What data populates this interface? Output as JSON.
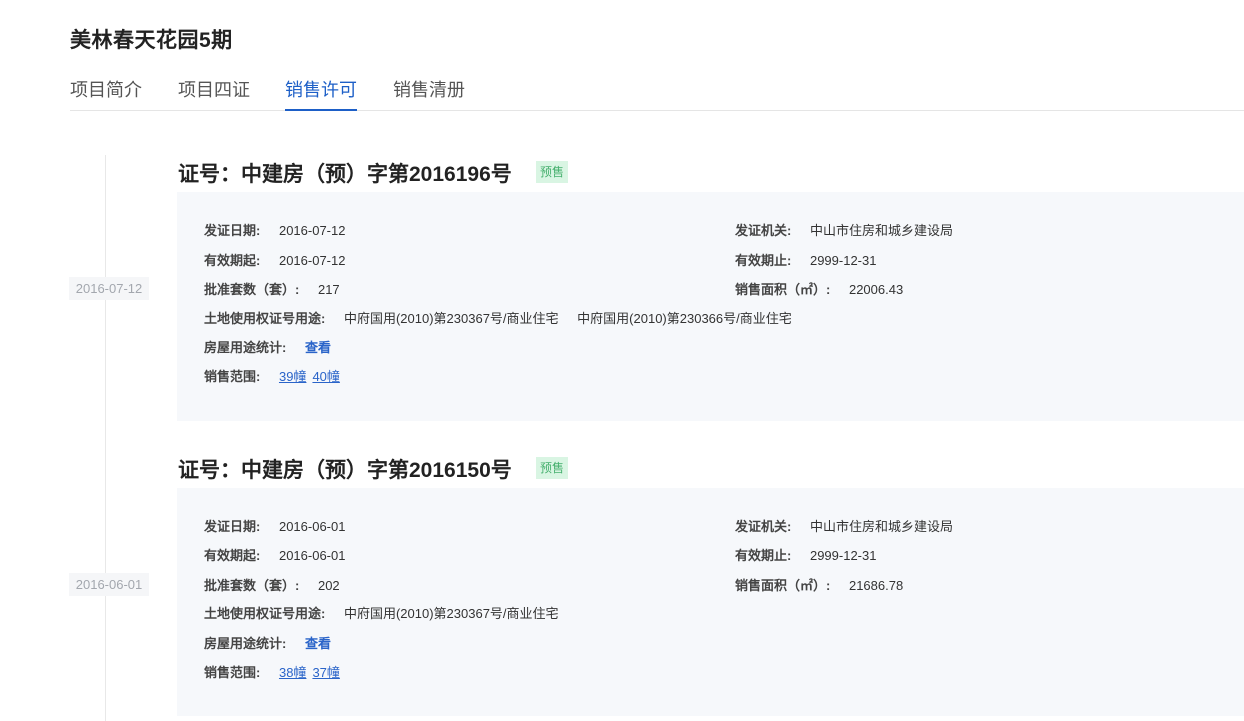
{
  "project": {
    "title": "美林春天花园5期"
  },
  "tabs": [
    {
      "label": "项目简介"
    },
    {
      "label": "项目四证"
    },
    {
      "label": "销售许可"
    },
    {
      "label": "销售清册"
    }
  ],
  "permits": [
    {
      "date": "2016-07-12",
      "title": "证号：中建房（预）字第2016196号",
      "badge": "预售",
      "issue_date_label": "发证日期:",
      "issue_date": "2016-07-12",
      "authority_label": "发证机关:",
      "authority": "中山市住房和城乡建设局",
      "valid_from_label": "有效期起:",
      "valid_from": "2016-07-12",
      "valid_to_label": "有效期止:",
      "valid_to": "2999-12-31",
      "units_label": "批准套数（套）:",
      "units": "217",
      "area_label": "销售面积（㎡）:",
      "area": "22006.43",
      "land_label": "土地使用权证号用途:",
      "land": [
        "中府国用(2010)第230367号/商业住宅",
        "中府国用(2010)第230366号/商业住宅"
      ],
      "usage_label": "房屋用途统计:",
      "usage_link": "查看",
      "scope_label": "销售范围:",
      "scope": [
        "39幢",
        "40幢"
      ]
    },
    {
      "date": "2016-06-01",
      "title": "证号：中建房（预）字第2016150号",
      "badge": "预售",
      "issue_date_label": "发证日期:",
      "issue_date": "2016-06-01",
      "authority_label": "发证机关:",
      "authority": "中山市住房和城乡建设局",
      "valid_from_label": "有效期起:",
      "valid_from": "2016-06-01",
      "valid_to_label": "有效期止:",
      "valid_to": "2999-12-31",
      "units_label": "批准套数（套）:",
      "units": "202",
      "area_label": "销售面积（㎡）:",
      "area": "21686.78",
      "land_label": "土地使用权证号用途:",
      "land": [
        "中府国用(2010)第230367号/商业住宅"
      ],
      "usage_label": "房屋用途统计:",
      "usage_link": "查看",
      "scope_label": "销售范围:",
      "scope": [
        "38幢",
        "37幢"
      ]
    }
  ]
}
